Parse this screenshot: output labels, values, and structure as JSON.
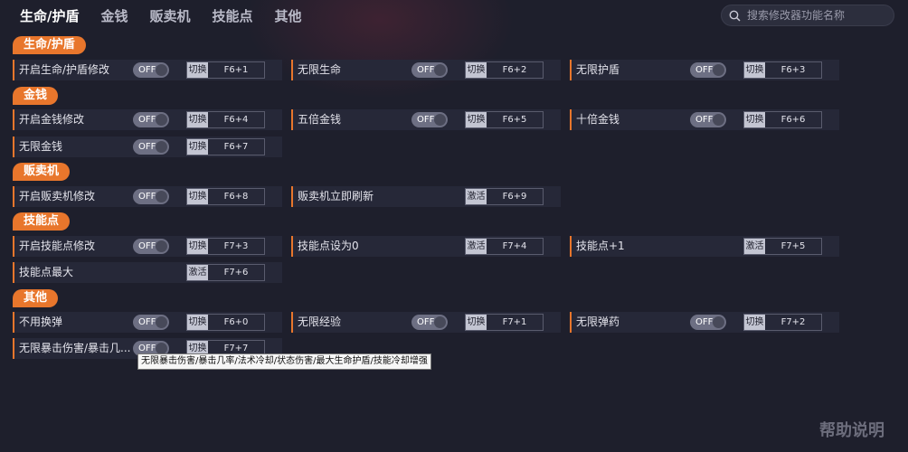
{
  "nav": {
    "tabs": [
      "生命/护盾",
      "金钱",
      "贩卖机",
      "技能点",
      "其他"
    ],
    "active": 0
  },
  "search": {
    "placeholder": "搜索修改器功能名称"
  },
  "sections": [
    {
      "title": "生命/护盾",
      "rows": [
        [
          {
            "label": "开启生命/护盾修改",
            "toggle": "OFF",
            "mode": "切换",
            "key": "F6+1"
          },
          {
            "label": "无限生命",
            "toggle": "OFF",
            "mode": "切换",
            "key": "F6+2"
          },
          {
            "label": "无限护盾",
            "toggle": "OFF",
            "mode": "切换",
            "key": "F6+3"
          }
        ]
      ]
    },
    {
      "title": "金钱",
      "rows": [
        [
          {
            "label": "开启金钱修改",
            "toggle": "OFF",
            "mode": "切换",
            "key": "F6+4"
          },
          {
            "label": "五倍金钱",
            "toggle": "OFF",
            "mode": "切换",
            "key": "F6+5"
          },
          {
            "label": "十倍金钱",
            "toggle": "OFF",
            "mode": "切换",
            "key": "F6+6"
          }
        ],
        [
          {
            "label": "无限金钱",
            "toggle": "OFF",
            "mode": "切换",
            "key": "F6+7"
          }
        ]
      ]
    },
    {
      "title": "贩卖机",
      "rows": [
        [
          {
            "label": "开启贩卖机修改",
            "toggle": "OFF",
            "mode": "切换",
            "key": "F6+8"
          },
          {
            "label": "贩卖机立即刷新",
            "toggle": null,
            "mode": "激活",
            "key": "F6+9"
          }
        ]
      ]
    },
    {
      "title": "技能点",
      "rows": [
        [
          {
            "label": "开启技能点修改",
            "toggle": "OFF",
            "mode": "切换",
            "key": "F7+3"
          },
          {
            "label": "技能点设为0",
            "toggle": null,
            "mode": "激活",
            "key": "F7+4"
          },
          {
            "label": "技能点+1",
            "toggle": null,
            "mode": "激活",
            "key": "F7+5"
          }
        ],
        [
          {
            "label": "技能点最大",
            "toggle": null,
            "mode": "激活",
            "key": "F7+6"
          }
        ]
      ]
    },
    {
      "title": "其他",
      "rows": [
        [
          {
            "label": "不用换弹",
            "toggle": "OFF",
            "mode": "切换",
            "key": "F6+0"
          },
          {
            "label": "无限经验",
            "toggle": "OFF",
            "mode": "切换",
            "key": "F7+1"
          },
          {
            "label": "无限弹药",
            "toggle": "OFF",
            "mode": "切换",
            "key": "F7+2"
          }
        ],
        [
          {
            "label": "无限暴击伤害/暴击几...",
            "toggle": "OFF",
            "mode": "切换",
            "key": "F7+7"
          }
        ]
      ]
    }
  ],
  "tooltip": "无限暴击伤害/暴击几率/法术冷却/状态伤害/最大生命护盾/技能冷却增强",
  "help": "帮助说明"
}
